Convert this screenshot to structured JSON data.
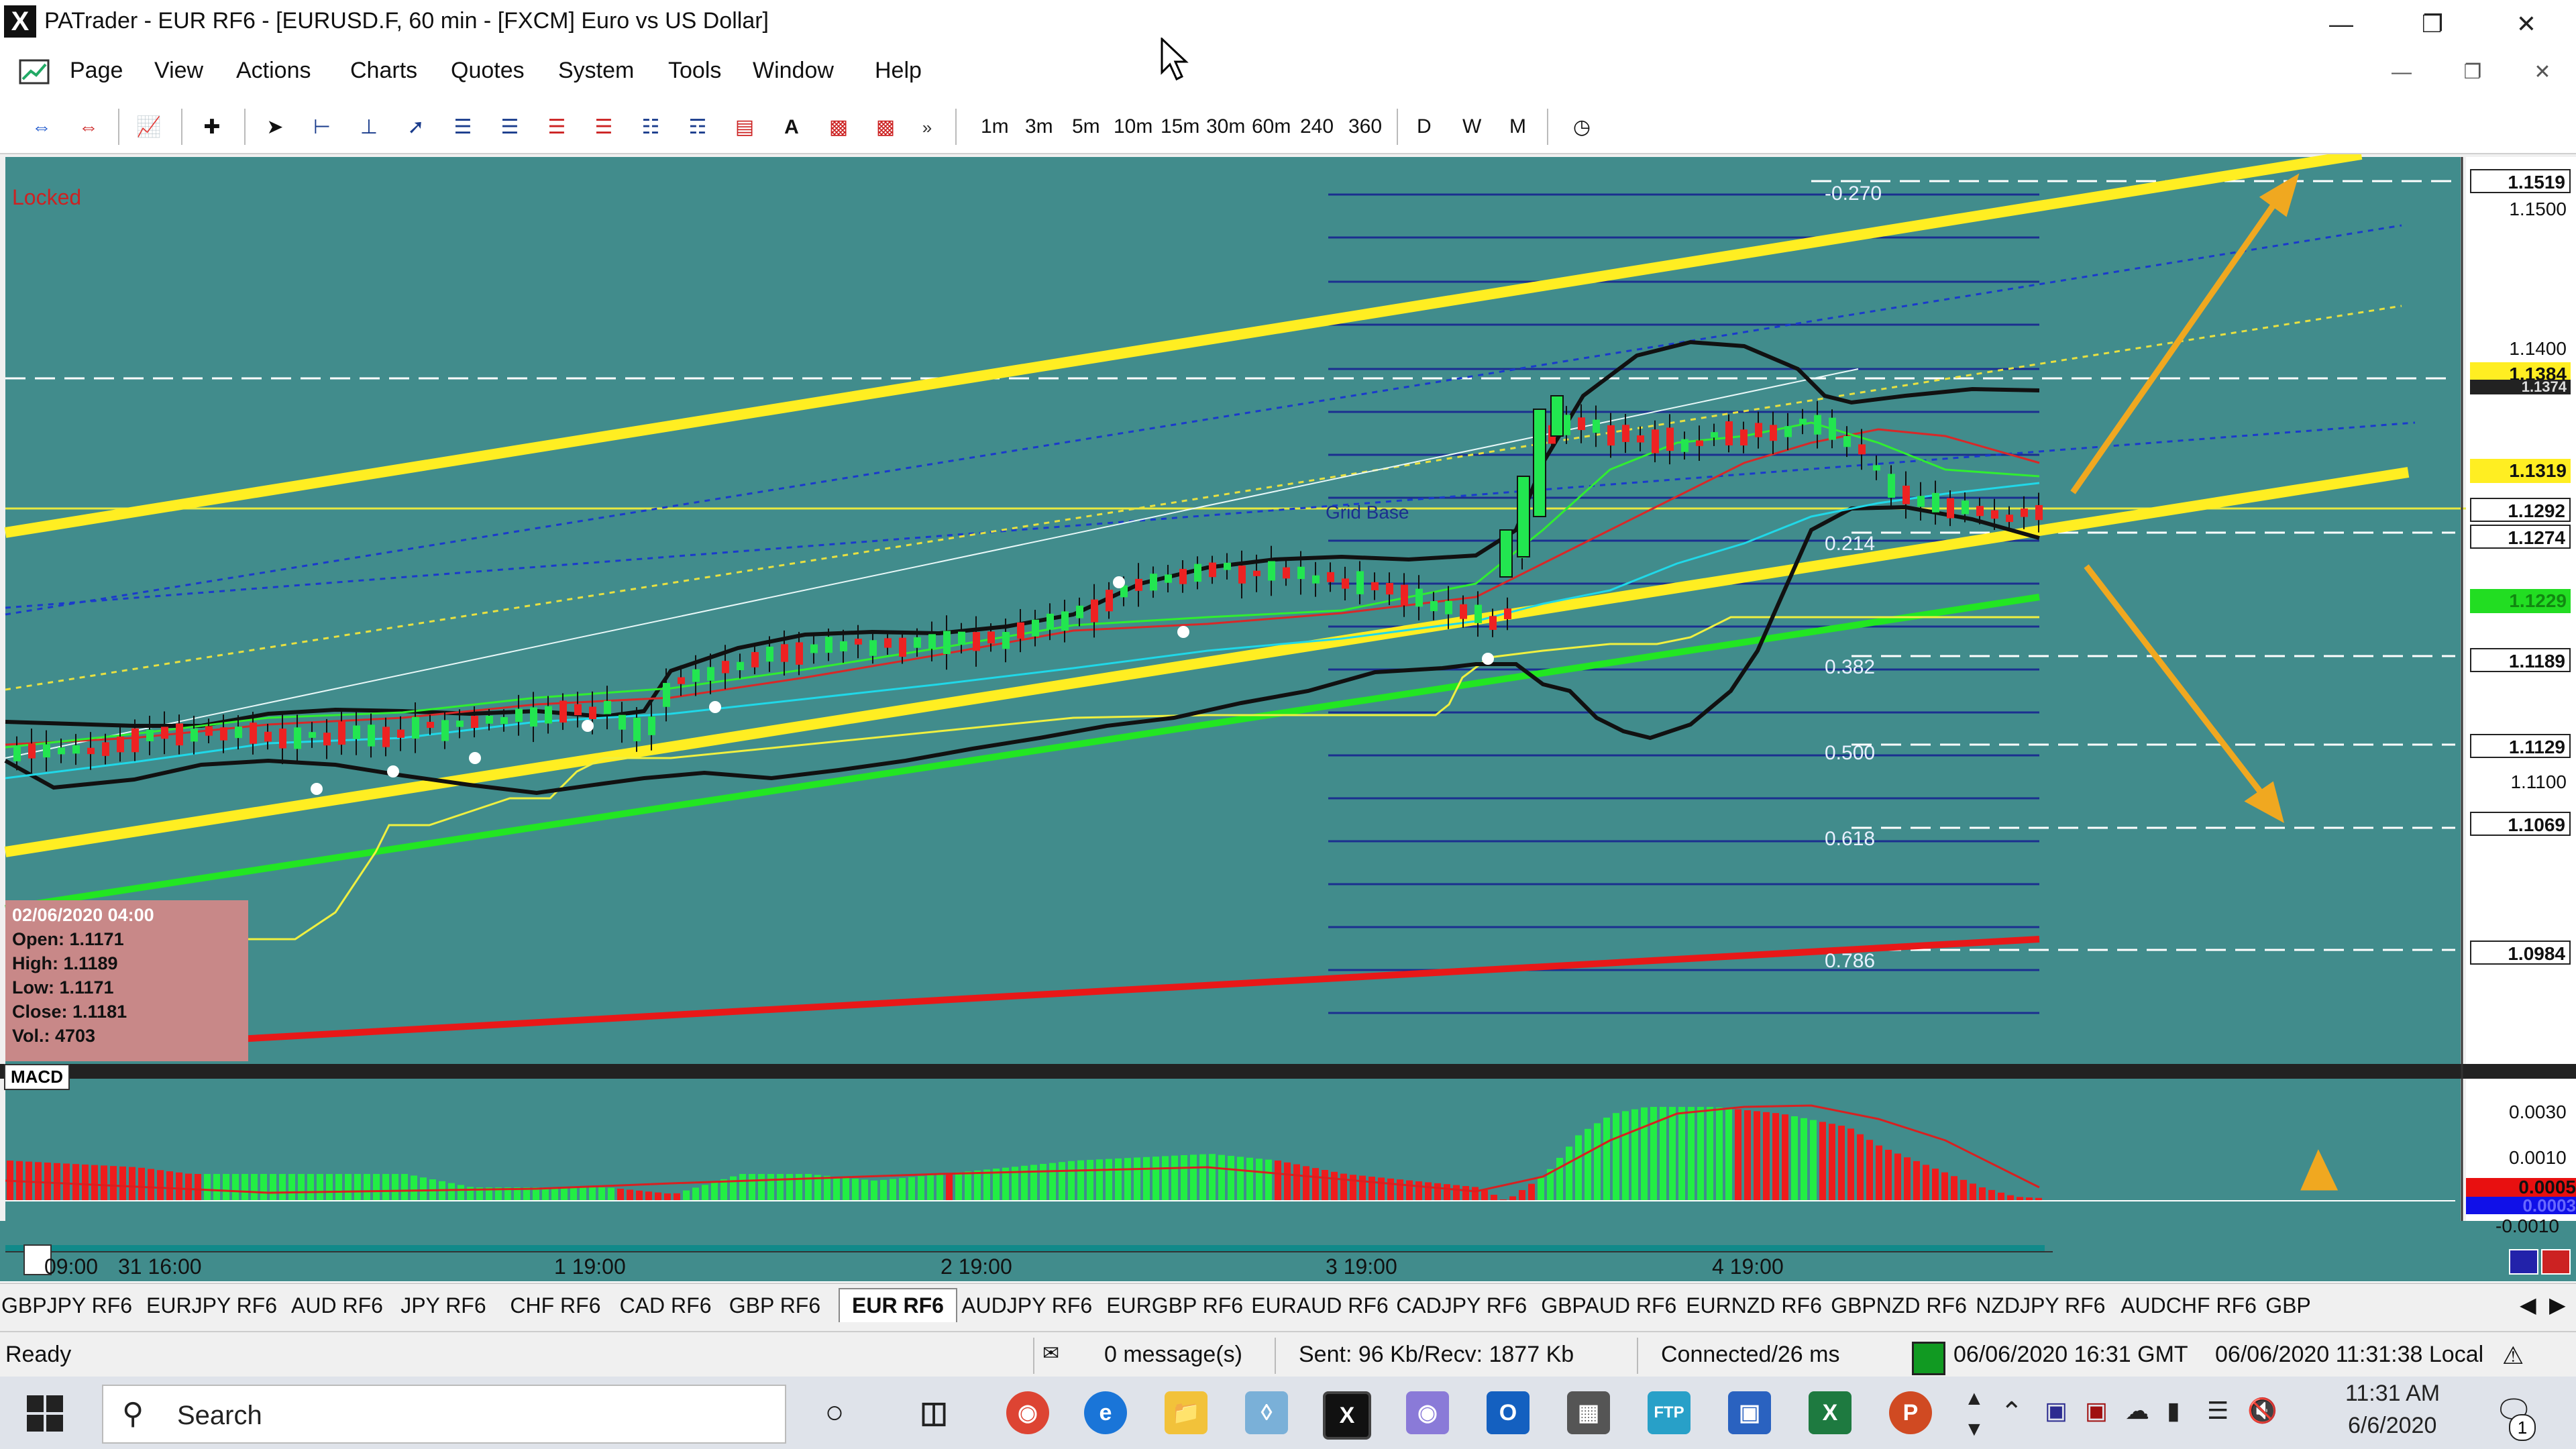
{
  "window": {
    "title": "PATrader - EUR RF6 - [EURUSD.F, 60 min - [FXCM] Euro vs US Dollar]"
  },
  "menu": [
    "Page",
    "View",
    "Actions",
    "Charts",
    "Quotes",
    "System",
    "Tools",
    "Window",
    "Help"
  ],
  "timeframes": [
    "1m",
    "3m",
    "5m",
    "10m",
    "15m",
    "30m",
    "60m",
    "240",
    "360",
    "D",
    "W",
    "M"
  ],
  "chart": {
    "locked_label": "Locked",
    "grid_base_label": "Grid Base",
    "fib_levels": [
      "-0.270",
      "0.214",
      "0.382",
      "0.500",
      "0.618",
      "0.786"
    ],
    "price_axis": [
      {
        "text": "1.1519",
        "style": "box"
      },
      {
        "text": "1.1500",
        "style": "plain"
      },
      {
        "text": "1.1400",
        "style": "plain"
      },
      {
        "text": "1.1384",
        "style": "yellow"
      },
      {
        "text": "1.1374",
        "style": "dark"
      },
      {
        "text": "1.1319",
        "style": "yellow"
      },
      {
        "text": "1.1292",
        "style": "box"
      },
      {
        "text": "1.1274",
        "style": "box"
      },
      {
        "text": "1.1229",
        "style": "green"
      },
      {
        "text": "1.1189",
        "style": "box"
      },
      {
        "text": "1.1129",
        "style": "box"
      },
      {
        "text": "1.1100",
        "style": "plain"
      },
      {
        "text": "1.1069",
        "style": "box"
      },
      {
        "text": "1.0984",
        "style": "box"
      }
    ],
    "info_box": {
      "date": "02/06/2020 04:00",
      "open": "Open: 1.1171",
      "high": "High: 1.1189",
      "low": "Low: 1.1171",
      "close": "Close: 1.1181",
      "vol": "Vol.: 4703"
    },
    "macd": {
      "label": "MACD",
      "axis": [
        "0.0030",
        "0.0010",
        "-0.0010"
      ],
      "value_red": "0.0005",
      "value_blue": "0.0003"
    },
    "time_axis": [
      "09:00",
      "31 16:00",
      "1 19:00",
      "2 19:00",
      "3 19:00",
      "4 19:00"
    ],
    "colors": {
      "background": "#418c8c",
      "bull": "#22e650",
      "bear": "#ee2222",
      "trend": "#ffee22",
      "arrow": "#f0a820"
    }
  },
  "tabs": {
    "items": [
      "GBPJPY RF6",
      "EURJPY RF6",
      "AUD RF6",
      "JPY RF6",
      "CHF RF6",
      "CAD RF6",
      "GBP RF6",
      "EUR RF6",
      "AUDJPY RF6",
      "EURGBP RF6",
      "EURAUD RF6",
      "CADJPY RF6",
      "GBPAUD RF6",
      "EURNZD RF6",
      "GBPNZD RF6",
      "NZDJPY RF6",
      "AUDCHF RF6",
      "GBP"
    ],
    "active": "EUR RF6"
  },
  "status": {
    "ready": "Ready",
    "messages": "0 message(s)",
    "traffic": "Sent: 96 Kb/Recv: 1877 Kb",
    "connection": "Connected/26 ms",
    "gmt": "06/06/2020 16:31 GMT",
    "local": "06/06/2020 11:31:38 Local"
  },
  "taskbar": {
    "search_label": "Search",
    "time": "11:31 AM",
    "date": "6/6/2020",
    "notification_count": "1"
  }
}
